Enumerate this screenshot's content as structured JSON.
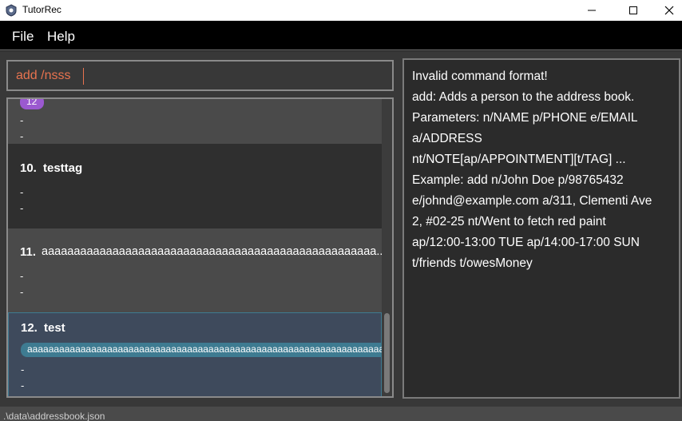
{
  "window": {
    "title": "TutorRec"
  },
  "menu": {
    "file": "File",
    "help": "Help"
  },
  "command": {
    "value": "add /nsss"
  },
  "persons": [
    {
      "index": "",
      "name": "",
      "tag": "12",
      "tag_color": "#9b59d0",
      "lines": [
        "-",
        "-"
      ]
    },
    {
      "index": "10.",
      "name": "testtag",
      "lines": [
        "-",
        "-"
      ]
    },
    {
      "index": "11.",
      "name": "aaaaaaaaaaaaaaaaaaaaaaaaaaaaaaaaaaaaaaaaaaaaaaaaaaaa...",
      "lines": [
        "-",
        "-"
      ]
    },
    {
      "index": "12.",
      "name": "test",
      "tag": "aaaaaaaaaaaaaaaaaaaaaaaaaaaaaaaaaaaaaaaaaaaaaaaaaaaaaaaaaaaaaaaaaaaaaaaaaaaa",
      "tag_color": "#3e7b91",
      "lines": [
        "-",
        "-"
      ],
      "selected": true
    }
  ],
  "result": {
    "text": "Invalid command format!\nadd: Adds a person to the address book.\nParameters: n/NAME p/PHONE e/EMAIL\na/ADDRESS\nnt/NOTE[ap/APPOINTMENT][t/TAG] ...\nExample: add n/John Doe p/98765432\ne/johnd@example.com a/311, Clementi Ave\n2, #02-25 nt/Went to fetch red paint\nap/12:00-13:00 TUE ap/14:00-17:00 SUN\nt/friends t/owesMoney"
  },
  "status": {
    "path": ".\\data\\addressbook.json"
  },
  "colors": {
    "accent": "#e8734f",
    "selected_bg": "#3e4a5c",
    "selected_border": "#3e7b91"
  }
}
